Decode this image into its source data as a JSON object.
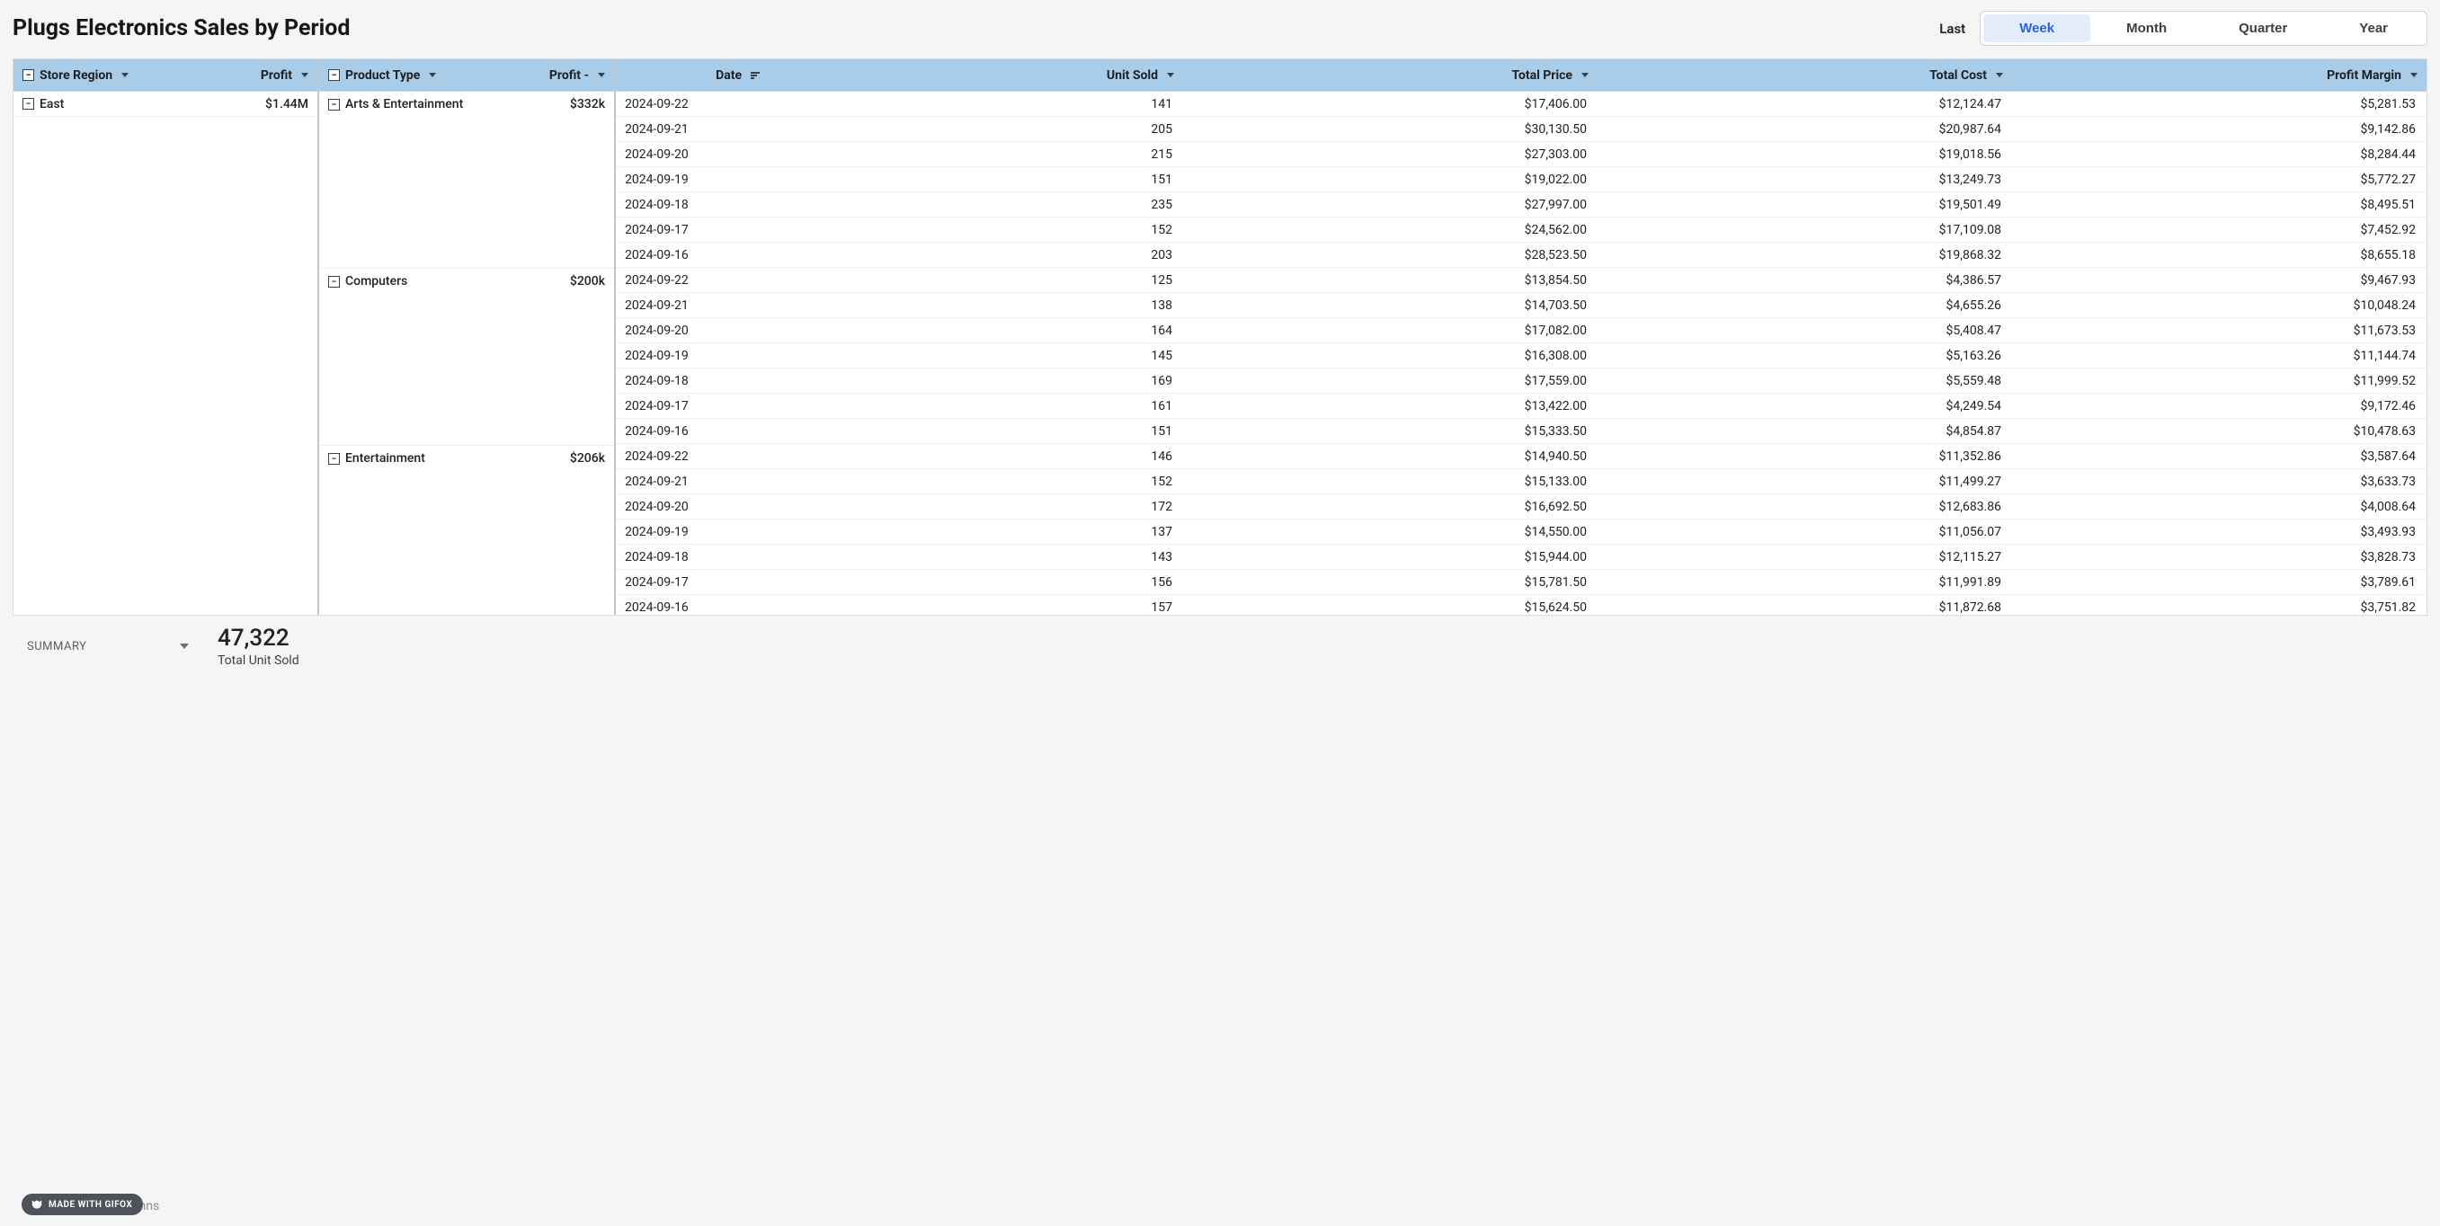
{
  "title": "Plugs Electronics Sales by Period",
  "period": {
    "label": "Last",
    "options": [
      "Week",
      "Month",
      "Quarter",
      "Year"
    ],
    "active": "Week"
  },
  "headers": {
    "region_col": "Store Region",
    "region_val": "Profit",
    "product_col": "Product Type",
    "product_val": "Profit -",
    "date": "Date",
    "unit_sold": "Unit Sold",
    "total_price": "Total Price",
    "total_cost": "Total Cost",
    "profit_margin": "Profit Margin"
  },
  "region": {
    "name": "East",
    "profit": "$1.44M"
  },
  "products": [
    {
      "name": "Arts & Entertainment",
      "profit": "$332k",
      "rows": [
        {
          "date": "2024-09-22",
          "unit_sold": "141",
          "total_price": "$17,406.00",
          "total_cost": "$12,124.47",
          "profit_margin": "$5,281.53"
        },
        {
          "date": "2024-09-21",
          "unit_sold": "205",
          "total_price": "$30,130.50",
          "total_cost": "$20,987.64",
          "profit_margin": "$9,142.86"
        },
        {
          "date": "2024-09-20",
          "unit_sold": "215",
          "total_price": "$27,303.00",
          "total_cost": "$19,018.56",
          "profit_margin": "$8,284.44"
        },
        {
          "date": "2024-09-19",
          "unit_sold": "151",
          "total_price": "$19,022.00",
          "total_cost": "$13,249.73",
          "profit_margin": "$5,772.27"
        },
        {
          "date": "2024-09-18",
          "unit_sold": "235",
          "total_price": "$27,997.00",
          "total_cost": "$19,501.49",
          "profit_margin": "$8,495.51"
        },
        {
          "date": "2024-09-17",
          "unit_sold": "152",
          "total_price": "$24,562.00",
          "total_cost": "$17,109.08",
          "profit_margin": "$7,452.92"
        },
        {
          "date": "2024-09-16",
          "unit_sold": "203",
          "total_price": "$28,523.50",
          "total_cost": "$19,868.32",
          "profit_margin": "$8,655.18"
        }
      ]
    },
    {
      "name": "Computers",
      "profit": "$200k",
      "rows": [
        {
          "date": "2024-09-22",
          "unit_sold": "125",
          "total_price": "$13,854.50",
          "total_cost": "$4,386.57",
          "profit_margin": "$9,467.93"
        },
        {
          "date": "2024-09-21",
          "unit_sold": "138",
          "total_price": "$14,703.50",
          "total_cost": "$4,655.26",
          "profit_margin": "$10,048.24"
        },
        {
          "date": "2024-09-20",
          "unit_sold": "164",
          "total_price": "$17,082.00",
          "total_cost": "$5,408.47",
          "profit_margin": "$11,673.53"
        },
        {
          "date": "2024-09-19",
          "unit_sold": "145",
          "total_price": "$16,308.00",
          "total_cost": "$5,163.26",
          "profit_margin": "$11,144.74"
        },
        {
          "date": "2024-09-18",
          "unit_sold": "169",
          "total_price": "$17,559.00",
          "total_cost": "$5,559.48",
          "profit_margin": "$11,999.52"
        },
        {
          "date": "2024-09-17",
          "unit_sold": "161",
          "total_price": "$13,422.00",
          "total_cost": "$4,249.54",
          "profit_margin": "$9,172.46"
        },
        {
          "date": "2024-09-16",
          "unit_sold": "151",
          "total_price": "$15,333.50",
          "total_cost": "$4,854.87",
          "profit_margin": "$10,478.63"
        }
      ]
    },
    {
      "name": "Entertainment",
      "profit": "$206k",
      "rows": [
        {
          "date": "2024-09-22",
          "unit_sold": "146",
          "total_price": "$14,940.50",
          "total_cost": "$11,352.86",
          "profit_margin": "$3,587.64"
        },
        {
          "date": "2024-09-21",
          "unit_sold": "152",
          "total_price": "$15,133.00",
          "total_cost": "$11,499.27",
          "profit_margin": "$3,633.73"
        },
        {
          "date": "2024-09-20",
          "unit_sold": "172",
          "total_price": "$16,692.50",
          "total_cost": "$12,683.86",
          "profit_margin": "$4,008.64"
        },
        {
          "date": "2024-09-19",
          "unit_sold": "137",
          "total_price": "$14,550.00",
          "total_cost": "$11,056.07",
          "profit_margin": "$3,493.93"
        },
        {
          "date": "2024-09-18",
          "unit_sold": "143",
          "total_price": "$15,944.00",
          "total_cost": "$12,115.27",
          "profit_margin": "$3,828.73"
        },
        {
          "date": "2024-09-17",
          "unit_sold": "156",
          "total_price": "$15,781.50",
          "total_cost": "$11,991.89",
          "profit_margin": "$3,789.61"
        },
        {
          "date": "2024-09-16",
          "unit_sold": "157",
          "total_price": "$15,624.50",
          "total_cost": "$11,872.68",
          "profit_margin": "$3,751.82"
        }
      ]
    }
  ],
  "summary": {
    "label": "SUMMARY",
    "metric_value": "47,322",
    "metric_label": "Total Unit Sold"
  },
  "badge": "MADE WITH GIFOX",
  "truncated": "mns"
}
